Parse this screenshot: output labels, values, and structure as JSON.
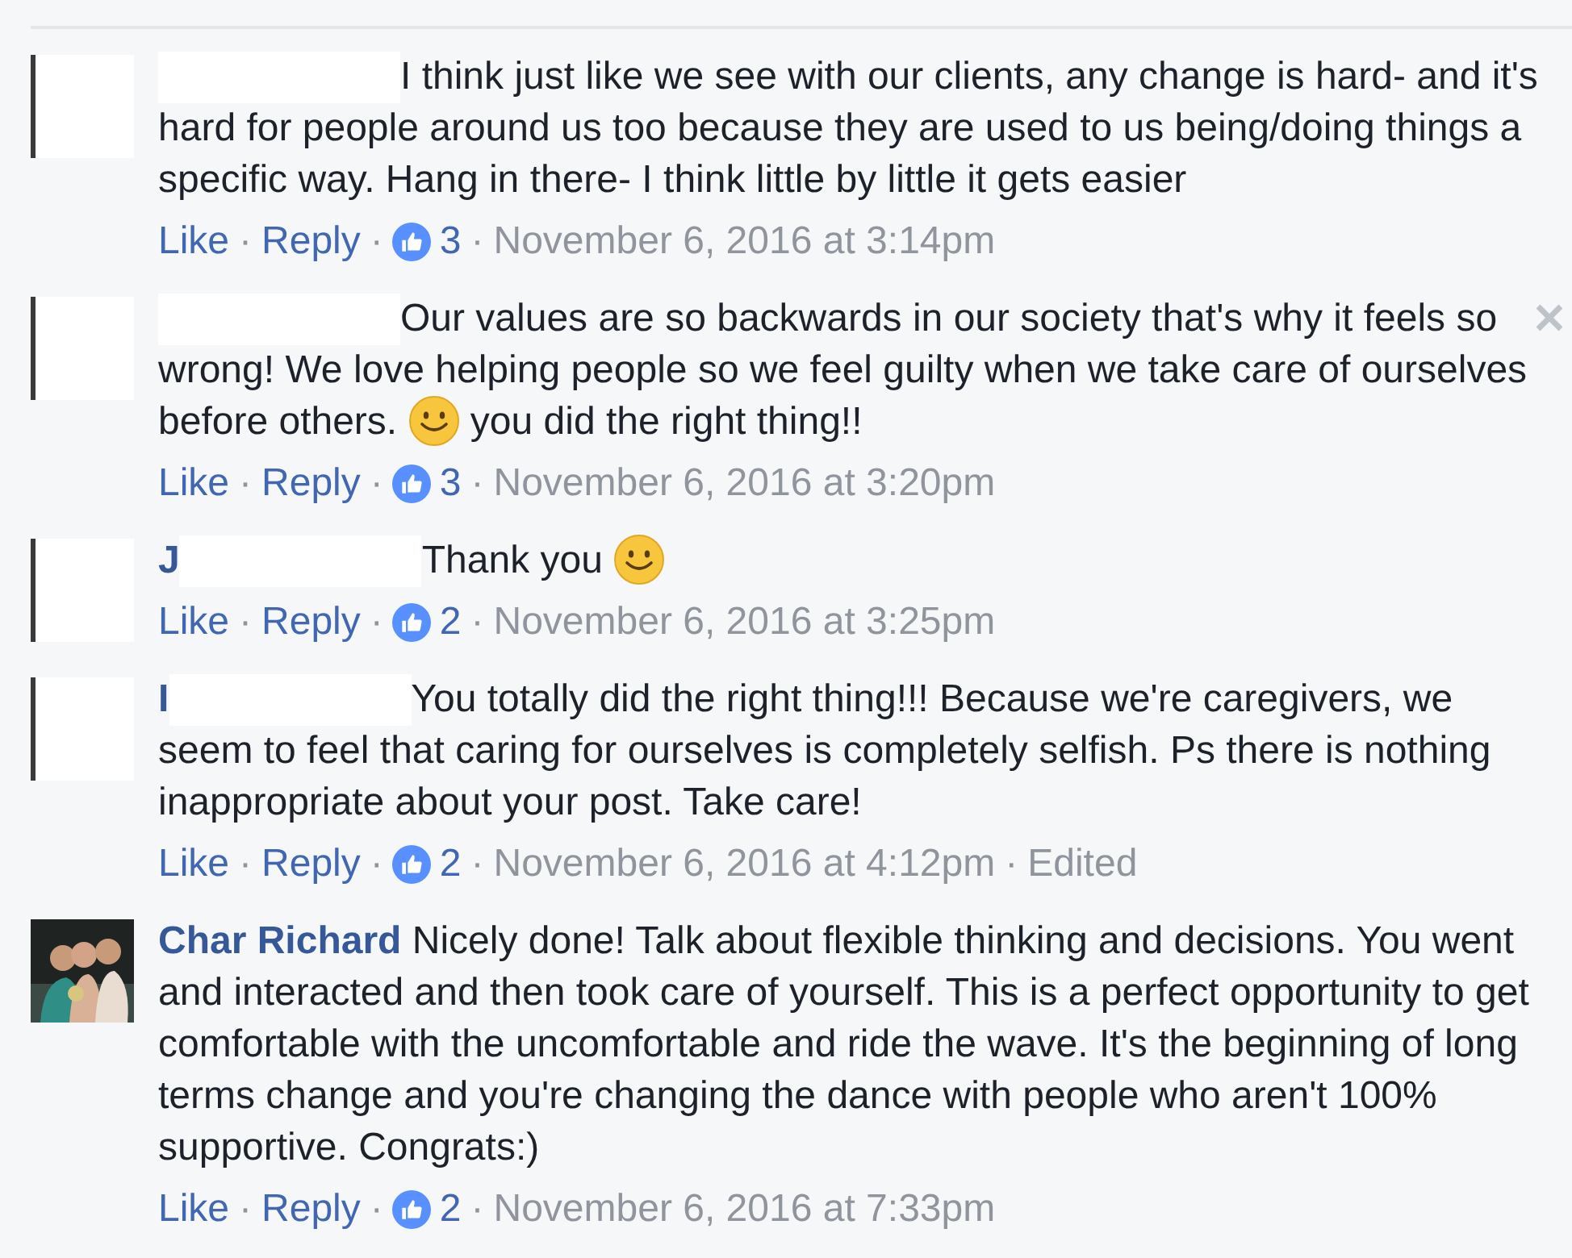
{
  "comments": [
    {
      "avatar": {
        "kind": "blank"
      },
      "redacted": true,
      "parts": [
        {
          "kind": "text",
          "text": "I think just like we see with our clients, any change is hard- and it's hard for people around us too because they are used to us being/doing things a specific way. Hang in there- I think little by little it gets easier"
        }
      ],
      "meta": [
        {
          "kind": "link",
          "text": "Like"
        },
        {
          "kind": "separator",
          "text": "·"
        },
        {
          "kind": "link",
          "text": "Reply"
        },
        {
          "kind": "separator",
          "text": "·"
        },
        {
          "kind": "likes",
          "text": "3"
        },
        {
          "kind": "separator",
          "text": "·"
        },
        {
          "kind": "time",
          "text": "November 6, 2016 at 3:14pm"
        }
      ],
      "close": false
    },
    {
      "avatar": {
        "kind": "blank"
      },
      "redacted": true,
      "parts": [
        {
          "kind": "text",
          "text": "Our values are so backwards in our society that's why it feels so wrong! We love helping people so we feel guilty when we take care of ourselves before others. "
        },
        {
          "kind": "emoji"
        },
        {
          "kind": "text",
          "text": " you did the right thing!!"
        }
      ],
      "meta": [
        {
          "kind": "link",
          "text": "Like"
        },
        {
          "kind": "separator",
          "text": "·"
        },
        {
          "kind": "link",
          "text": "Reply"
        },
        {
          "kind": "separator",
          "text": "·"
        },
        {
          "kind": "likes",
          "text": "3"
        },
        {
          "kind": "separator",
          "text": "·"
        },
        {
          "kind": "time",
          "text": "November 6, 2016 at 3:20pm"
        }
      ],
      "close": true
    },
    {
      "avatar": {
        "kind": "blank"
      },
      "name": "J",
      "redacted": true,
      "parts": [
        {
          "kind": "text",
          "text": "Thank you "
        },
        {
          "kind": "emoji"
        }
      ],
      "meta": [
        {
          "kind": "link",
          "text": "Like"
        },
        {
          "kind": "separator",
          "text": "·"
        },
        {
          "kind": "link",
          "text": "Reply"
        },
        {
          "kind": "separator",
          "text": "·"
        },
        {
          "kind": "likes",
          "text": "2"
        },
        {
          "kind": "separator",
          "text": "·"
        },
        {
          "kind": "time",
          "text": "November 6, 2016 at 3:25pm"
        }
      ],
      "close": false
    },
    {
      "avatar": {
        "kind": "blank"
      },
      "name": "I",
      "redacted": true,
      "parts": [
        {
          "kind": "text",
          "text": "You totally did the right thing!!! Because we're caregivers, we seem to feel that caring for ourselves is completely selfish. Ps there is nothing inappropriate about your post. Take care!"
        }
      ],
      "meta": [
        {
          "kind": "link",
          "text": "Like"
        },
        {
          "kind": "separator",
          "text": "·"
        },
        {
          "kind": "link",
          "text": "Reply"
        },
        {
          "kind": "separator",
          "text": "·"
        },
        {
          "kind": "likes",
          "text": "2"
        },
        {
          "kind": "separator",
          "text": "·"
        },
        {
          "kind": "time",
          "text": "November 6, 2016 at 4:12pm"
        },
        {
          "kind": "separator",
          "text": "·"
        },
        {
          "kind": "time",
          "text": "Edited"
        }
      ],
      "close": false
    },
    {
      "avatar": {
        "kind": "picture"
      },
      "name": "Char Richard",
      "redacted": false,
      "parts": [
        {
          "kind": "text",
          "text": "Nicely done! Talk about flexible thinking and decisions. You went and interacted and then took care of yourself. This is a perfect opportunity to get comfortable with the uncomfortable and ride the wave. It's the beginning of long terms change and you're changing the dance with people who aren't 100% supportive. Congrats:)"
        }
      ],
      "meta": [
        {
          "kind": "link",
          "text": "Like"
        },
        {
          "kind": "separator",
          "text": "·"
        },
        {
          "kind": "link",
          "text": "Reply"
        },
        {
          "kind": "separator",
          "text": "·"
        },
        {
          "kind": "likes",
          "text": "2"
        },
        {
          "kind": "separator",
          "text": "·"
        },
        {
          "kind": "time",
          "text": "November 6, 2016 at 7:33pm"
        }
      ],
      "close": false
    }
  ]
}
